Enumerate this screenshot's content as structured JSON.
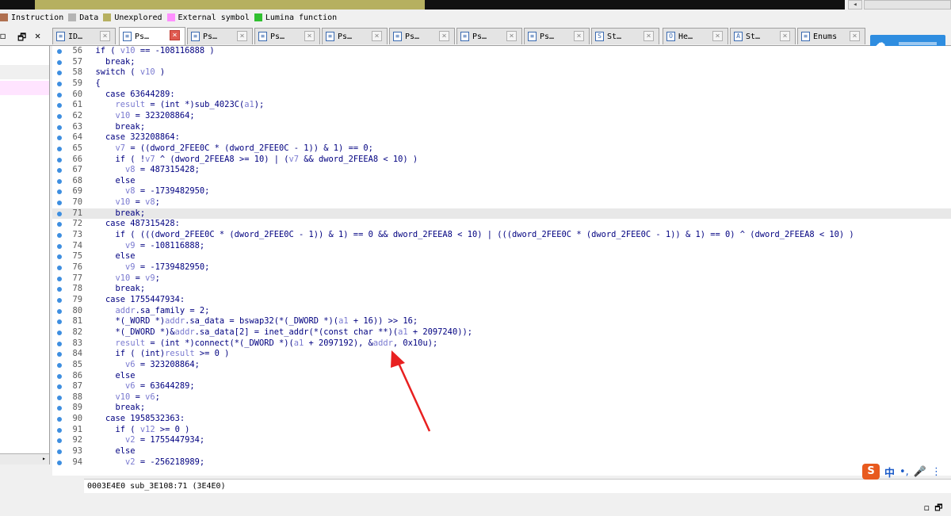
{
  "legend": [
    {
      "label": "Instruction",
      "color": "#b07050"
    },
    {
      "label": "Data",
      "color": "#b4b4b4"
    },
    {
      "label": "Unexplored",
      "color": "#b6b060"
    },
    {
      "label": "External symbol",
      "color": "#ff90ff"
    },
    {
      "label": "Lumina function",
      "color": "#30c030"
    }
  ],
  "window_controls": {
    "restore": "🗗",
    "close": "✕"
  },
  "tabs": [
    {
      "label": "ID…",
      "icon": "ida-view-icon",
      "glyph": "≡",
      "active": false
    },
    {
      "label": "Ps…",
      "icon": "pseudocode-icon",
      "glyph": "≡",
      "active": true
    },
    {
      "label": "Ps…",
      "icon": "pseudocode-icon",
      "glyph": "≡",
      "active": false
    },
    {
      "label": "Ps…",
      "icon": "pseudocode-icon",
      "glyph": "≡",
      "active": false
    },
    {
      "label": "Ps…",
      "icon": "pseudocode-icon",
      "glyph": "≡",
      "active": false
    },
    {
      "label": "Ps…",
      "icon": "pseudocode-icon",
      "glyph": "≡",
      "active": false
    },
    {
      "label": "Ps…",
      "icon": "pseudocode-icon",
      "glyph": "≡",
      "active": false
    },
    {
      "label": "Ps…",
      "icon": "pseudocode-icon",
      "glyph": "≡",
      "active": false
    },
    {
      "label": "St…",
      "icon": "strings-icon",
      "glyph": "S",
      "active": false
    },
    {
      "label": "He…",
      "icon": "hex-view-icon",
      "glyph": "O",
      "active": false
    },
    {
      "label": "St…",
      "icon": "structures-icon",
      "glyph": "A",
      "active": false
    },
    {
      "label": "Enums",
      "icon": "enums-icon",
      "glyph": "≡",
      "active": false
    }
  ],
  "code_lines": [
    {
      "n": "56",
      "t": "  if ( v10 == -108116888 )"
    },
    {
      "n": "57",
      "t": "    break;"
    },
    {
      "n": "58",
      "t": "  switch ( v10 )"
    },
    {
      "n": "59",
      "t": "  {"
    },
    {
      "n": "60",
      "t": "    case 63644289:"
    },
    {
      "n": "61",
      "t": "      result = (int *)sub_4023C(a1);"
    },
    {
      "n": "62",
      "t": "      v10 = 323208864;"
    },
    {
      "n": "63",
      "t": "      break;"
    },
    {
      "n": "64",
      "t": "    case 323208864:"
    },
    {
      "n": "65",
      "t": "      v7 = ((dword_2FEE0C * (dword_2FEE0C - 1)) & 1) == 0;"
    },
    {
      "n": "66",
      "t": "      if ( !v7 ^ (dword_2FEEA8 >= 10) | (v7 && dword_2FEEA8 < 10) )"
    },
    {
      "n": "67",
      "t": "        v8 = 487315428;"
    },
    {
      "n": "68",
      "t": "      else"
    },
    {
      "n": "69",
      "t": "        v8 = -1739482950;"
    },
    {
      "n": "70",
      "t": "      v10 = v8;"
    },
    {
      "n": "71",
      "t": "      break;"
    },
    {
      "n": "72",
      "t": "    case 487315428:"
    },
    {
      "n": "73",
      "t": "      if ( (((dword_2FEE0C * (dword_2FEE0C - 1)) & 1) == 0 && dword_2FEEA8 < 10) | (((dword_2FEE0C * (dword_2FEE0C - 1)) & 1) == 0) ^ (dword_2FEEA8 < 10) )"
    },
    {
      "n": "74",
      "t": "        v9 = -108116888;"
    },
    {
      "n": "75",
      "t": "      else"
    },
    {
      "n": "76",
      "t": "        v9 = -1739482950;"
    },
    {
      "n": "77",
      "t": "      v10 = v9;"
    },
    {
      "n": "78",
      "t": "      break;"
    },
    {
      "n": "79",
      "t": "    case 1755447934:"
    },
    {
      "n": "80",
      "t": "      addr.sa_family = 2;"
    },
    {
      "n": "81",
      "t": "      *(_WORD *)addr.sa_data = bswap32(*(_DWORD *)(a1 + 16)) >> 16;"
    },
    {
      "n": "82",
      "t": "      *(_DWORD *)&addr.sa_data[2] = inet_addr(*(const char **)(a1 + 2097240));"
    },
    {
      "n": "83",
      "t": "      result = (int *)connect(*(_DWORD *)(a1 + 2097192), &addr, 0x10u);"
    },
    {
      "n": "84",
      "t": "      if ( (int)result >= 0 )"
    },
    {
      "n": "85",
      "t": "        v6 = 323208864;"
    },
    {
      "n": "86",
      "t": "      else"
    },
    {
      "n": "87",
      "t": "        v6 = 63644289;"
    },
    {
      "n": "88",
      "t": "      v10 = v6;"
    },
    {
      "n": "89",
      "t": "      break;"
    },
    {
      "n": "90",
      "t": "    case 1958532363:"
    },
    {
      "n": "91",
      "t": "      if ( v12 >= 0 )"
    },
    {
      "n": "92",
      "t": "        v2 = 1755447934;"
    },
    {
      "n": "93",
      "t": "      else"
    },
    {
      "n": "94",
      "t": "        v2 = -256218989;"
    }
  ],
  "highlighted_line": "71",
  "status": "0003E4E0 sub_3E108:71 (3E4E0)",
  "ime": {
    "logo": "S",
    "lang": "中",
    "punct": "•,",
    "mic": "🎤",
    "more": "⋮"
  },
  "colors": {
    "code_text": "#000080",
    "variable": "#7a7ad0",
    "breakpoint_dot": "#3d8ee0",
    "arrow": "#e82020"
  }
}
